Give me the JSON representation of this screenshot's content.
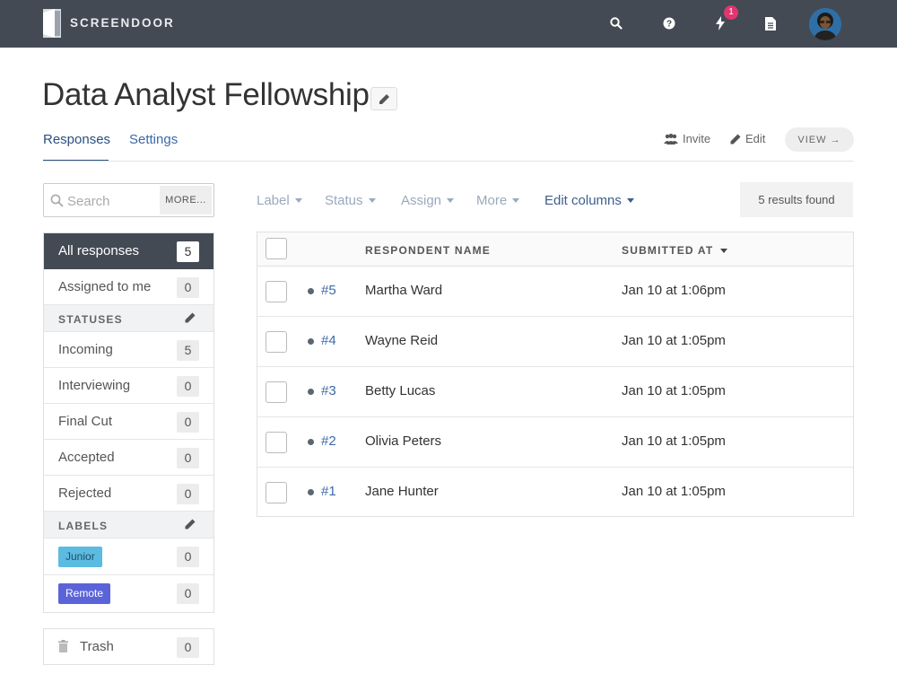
{
  "app": {
    "name": "SCREENDOOR"
  },
  "topbar": {
    "icons": [
      "search-icon",
      "help-icon",
      "bolt-icon",
      "document-icon"
    ],
    "notification_count": "1"
  },
  "page": {
    "title": "Data Analyst Fellowship"
  },
  "tabs": [
    {
      "label": "Responses",
      "active": true
    },
    {
      "label": "Settings",
      "active": false
    }
  ],
  "header_actions": {
    "invite": "Invite",
    "edit": "Edit",
    "view": "VIEW →"
  },
  "search": {
    "placeholder": "Search",
    "more": "MORE..."
  },
  "sidebar": {
    "main": [
      {
        "label": "All responses",
        "count": "5",
        "active": true
      },
      {
        "label": "Assigned to me",
        "count": "0",
        "active": false
      }
    ],
    "statuses_title": "STATUSES",
    "statuses": [
      {
        "label": "Incoming",
        "count": "5"
      },
      {
        "label": "Interviewing",
        "count": "0"
      },
      {
        "label": "Final Cut",
        "count": "0"
      },
      {
        "label": "Accepted",
        "count": "0"
      },
      {
        "label": "Rejected",
        "count": "0"
      }
    ],
    "labels_title": "LABELS",
    "labels": [
      {
        "label": "Junior",
        "count": "0",
        "color": "#5bbbe0"
      },
      {
        "label": "Remote",
        "count": "0",
        "color": "#5b63d8"
      }
    ],
    "trash": {
      "label": "Trash",
      "count": "0"
    }
  },
  "filters": {
    "label": "Label",
    "status": "Status",
    "assign": "Assign",
    "more": "More",
    "edit_columns": "Edit columns"
  },
  "results_text": "5 results found",
  "table": {
    "headers": {
      "name": "RESPONDENT NAME",
      "submitted": "SUBMITTED AT"
    },
    "rows": [
      {
        "id": "#5",
        "name": "Martha Ward",
        "submitted": "Jan 10 at 1:06pm"
      },
      {
        "id": "#4",
        "name": "Wayne Reid",
        "submitted": "Jan 10 at 1:05pm"
      },
      {
        "id": "#3",
        "name": "Betty Lucas",
        "submitted": "Jan 10 at 1:05pm"
      },
      {
        "id": "#2",
        "name": "Olivia Peters",
        "submitted": "Jan 10 at 1:05pm"
      },
      {
        "id": "#1",
        "name": "Jane Hunter",
        "submitted": "Jan 10 at 1:05pm"
      }
    ]
  },
  "colors": {
    "topbar": "#434a54",
    "link": "#3b6aa8",
    "notification": "#e0366f"
  }
}
